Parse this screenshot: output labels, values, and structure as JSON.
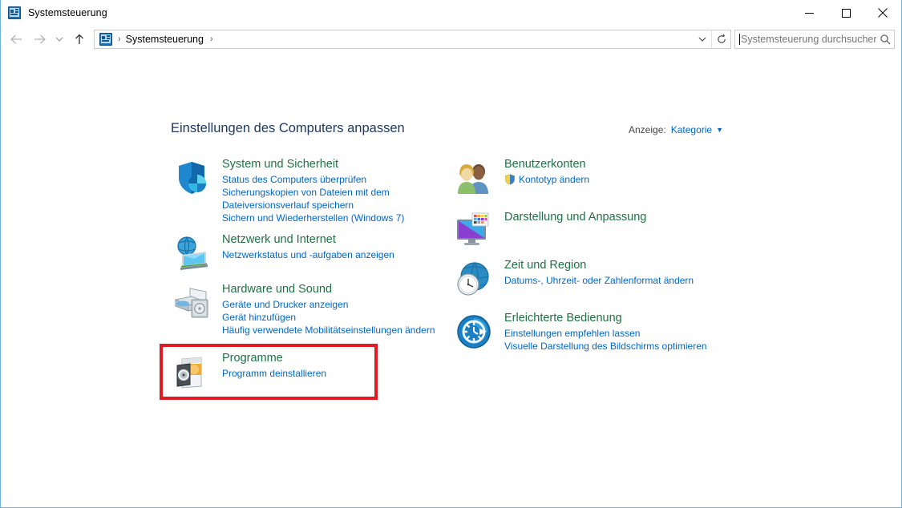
{
  "window": {
    "title": "Systemsteuerung",
    "icon": "control-panel-icon",
    "controls": {
      "minimize": "minimize-icon",
      "maximize": "maximize-icon",
      "close": "close-icon"
    }
  },
  "navbar": {
    "back": "back-arrow-icon",
    "forward": "forward-arrow-icon",
    "recent": "chevron-down-icon",
    "up": "up-arrow-icon",
    "breadcrumb_icon": "control-panel-icon",
    "breadcrumb": "Systemsteuerung",
    "separator": "›",
    "dropdown": "chevron-down-icon",
    "refresh": "refresh-icon"
  },
  "search": {
    "placeholder": "Systemsteuerung durchsuchen",
    "icon": "search-icon",
    "focused": true
  },
  "main": {
    "heading": "Einstellungen des Computers anpassen",
    "view": {
      "label": "Anzeige:",
      "value": "Kategorie",
      "caret": "▼"
    }
  },
  "colors": {
    "heading": "#1f3864",
    "category_title": "#1e7145",
    "link": "#0066cc",
    "highlight": "#e01b24",
    "window_border": "#70b3d6"
  },
  "highlight": {
    "target": "Programme",
    "color": "#e01b24"
  },
  "categories": {
    "left": [
      {
        "id": "system",
        "icon": "shield-security-icon",
        "title": "System und Sicherheit",
        "links": [
          {
            "text": "Status des Computers überprüfen",
            "shield": false
          },
          {
            "text": "Sicherungskopien von Dateien mit dem",
            "shield": false
          },
          {
            "text": "Dateiversionsverlauf speichern",
            "shield": false
          },
          {
            "text": "Sichern und Wiederherstellen (Windows 7)",
            "shield": false
          }
        ]
      },
      {
        "id": "network",
        "icon": "network-globe-icon",
        "title": "Netzwerk und Internet",
        "links": [
          {
            "text": "Netzwerkstatus und -aufgaben anzeigen",
            "shield": false
          }
        ]
      },
      {
        "id": "hardware",
        "icon": "printer-device-icon",
        "title": "Hardware und Sound",
        "links": [
          {
            "text": "Geräte und Drucker anzeigen",
            "shield": false
          },
          {
            "text": "Gerät hinzufügen",
            "shield": false
          },
          {
            "text": "Häufig verwendete Mobilitätseinstellungen ändern",
            "shield": false
          }
        ]
      },
      {
        "id": "programme",
        "icon": "programs-disc-icon",
        "title": "Programme",
        "links": [
          {
            "text": "Programm deinstallieren",
            "shield": false
          }
        ]
      }
    ],
    "right": [
      {
        "id": "benutzer",
        "icon": "user-accounts-icon",
        "title": "Benutzerkonten",
        "links": [
          {
            "text": "Kontotyp ändern",
            "shield": true
          }
        ]
      },
      {
        "id": "darstellung",
        "icon": "appearance-monitor-icon",
        "title": "Darstellung und Anpassung",
        "links": []
      },
      {
        "id": "zeit",
        "icon": "clock-globe-icon",
        "title": "Zeit und Region",
        "links": [
          {
            "text": "Datums-, Uhrzeit- oder Zahlenformat ändern",
            "shield": false
          }
        ]
      },
      {
        "id": "erleichtert",
        "icon": "ease-of-access-icon",
        "title": "Erleichterte Bedienung",
        "links": [
          {
            "text": "Einstellungen empfehlen lassen",
            "shield": false
          },
          {
            "text": "Visuelle Darstellung des Bildschirms optimieren",
            "shield": false
          }
        ]
      }
    ]
  }
}
